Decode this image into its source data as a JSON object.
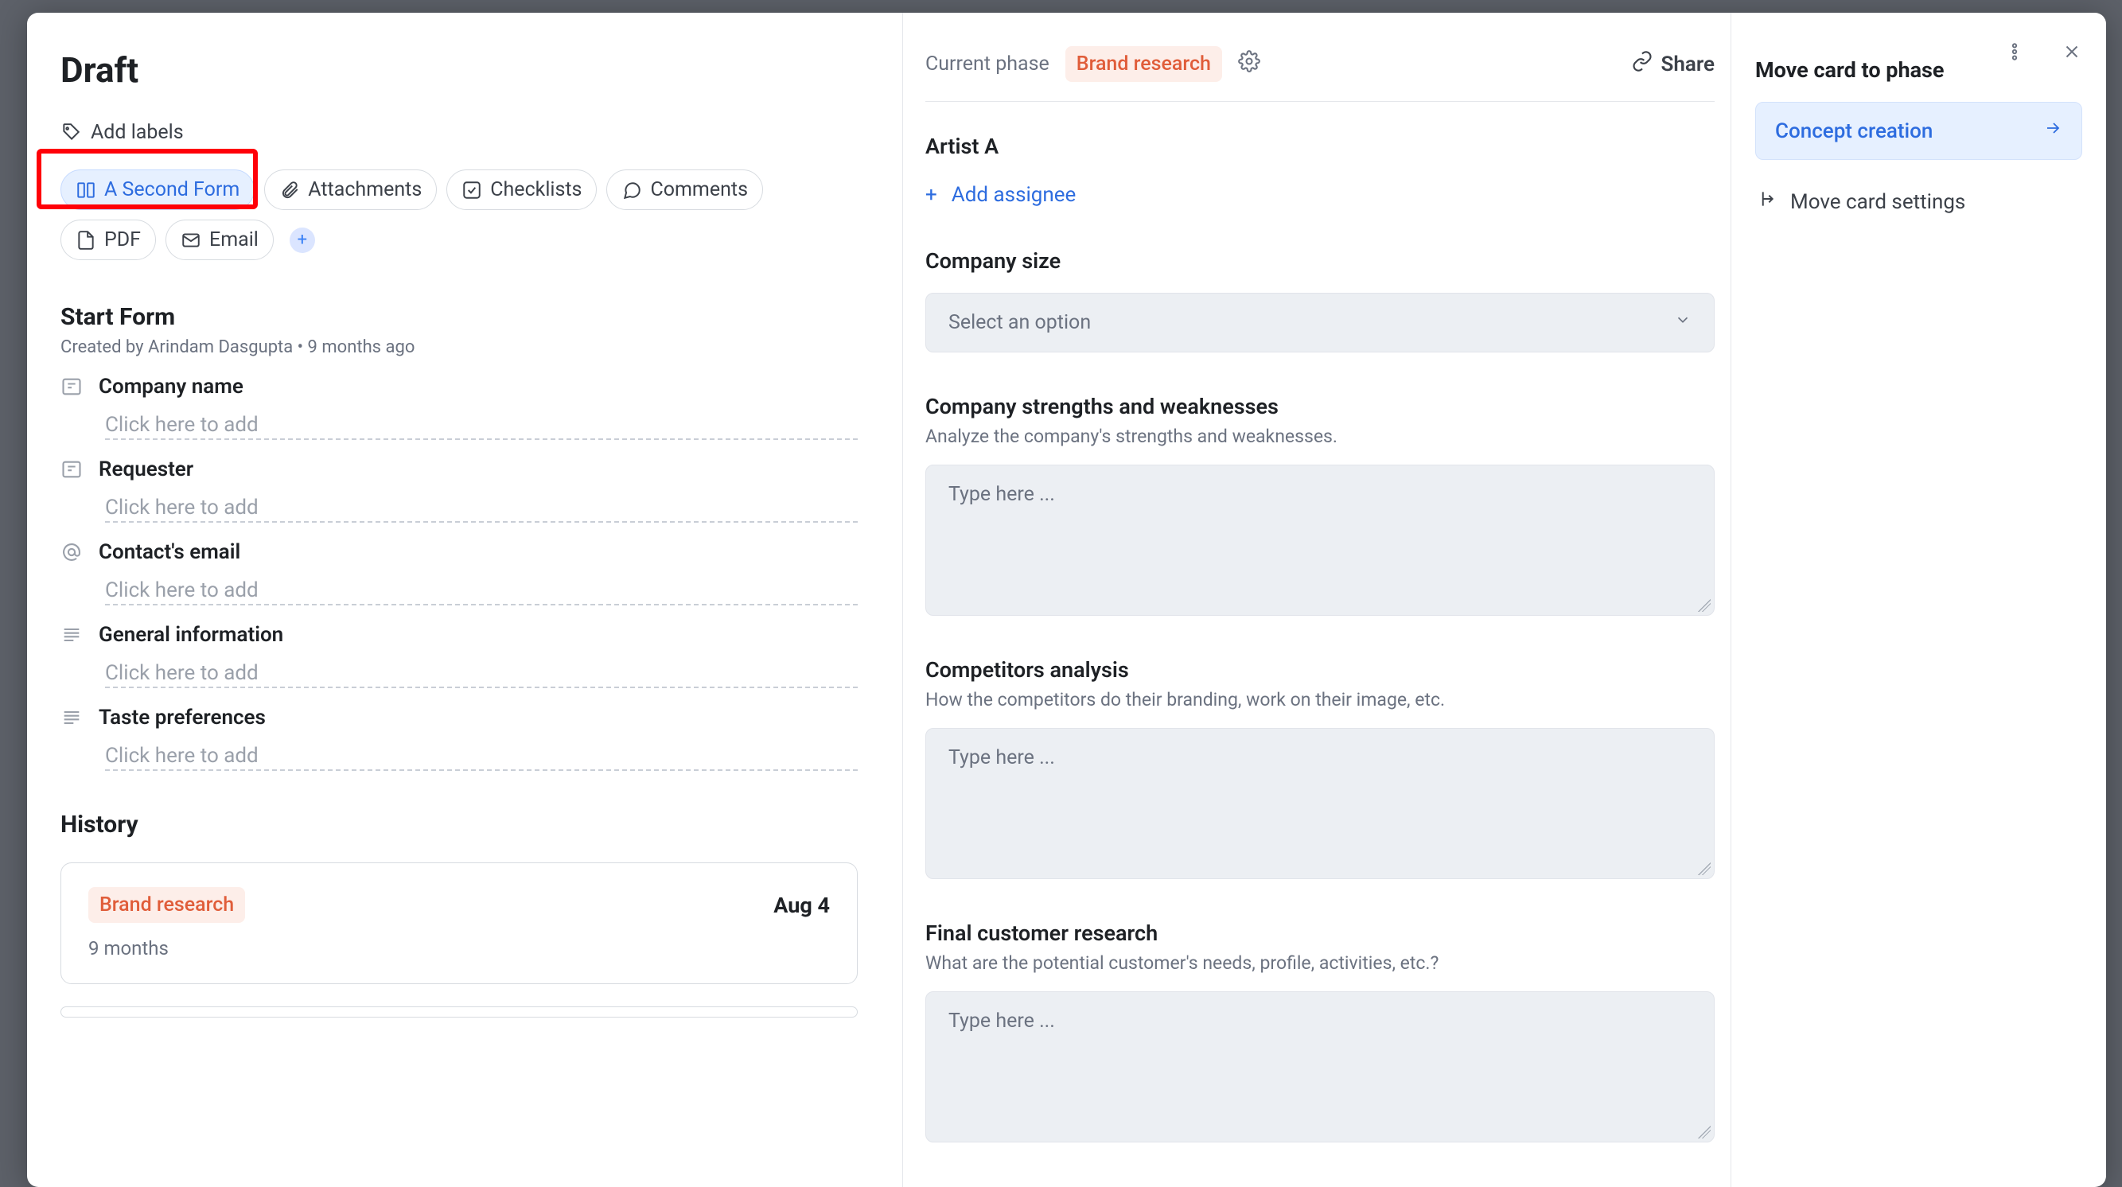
{
  "left": {
    "title": "Draft",
    "add_labels": "Add labels",
    "tabs": {
      "second_form": "A Second Form",
      "attachments": "Attachments",
      "checklists": "Checklists",
      "comments": "Comments",
      "pdf": "PDF",
      "email": "Email"
    },
    "start_form": {
      "title": "Start Form",
      "created_by": "Created by Arindam Dasgupta • 9 months ago"
    },
    "fields": {
      "company_name": "Company name",
      "requester": "Requester",
      "contacts_email": "Contact's email",
      "general_information": "General information",
      "taste_preferences": "Taste preferences",
      "click_here": "Click here to add"
    },
    "history": {
      "title": "History",
      "phase": "Brand research",
      "date": "Aug 4",
      "ago": "9 months"
    }
  },
  "mid": {
    "current_phase_label": "Current phase",
    "phase": "Brand research",
    "share": "Share",
    "artist": "Artist A",
    "add_assignee": "Add assignee",
    "company_size": {
      "title": "Company size",
      "placeholder": "Select an option"
    },
    "strengths": {
      "title": "Company strengths and weaknesses",
      "desc": "Analyze the company's strengths and weaknesses.",
      "placeholder": "Type here ..."
    },
    "competitors": {
      "title": "Competitors analysis",
      "desc": "How the competitors do their branding, work on their image, etc.",
      "placeholder": "Type here ..."
    },
    "final_customer": {
      "title": "Final customer research",
      "desc": "What are the potential customer's needs, profile, activities, etc.?",
      "placeholder": "Type here ..."
    }
  },
  "right": {
    "move_title": "Move card to phase",
    "concept_creation": "Concept creation",
    "move_settings": "Move card settings"
  }
}
